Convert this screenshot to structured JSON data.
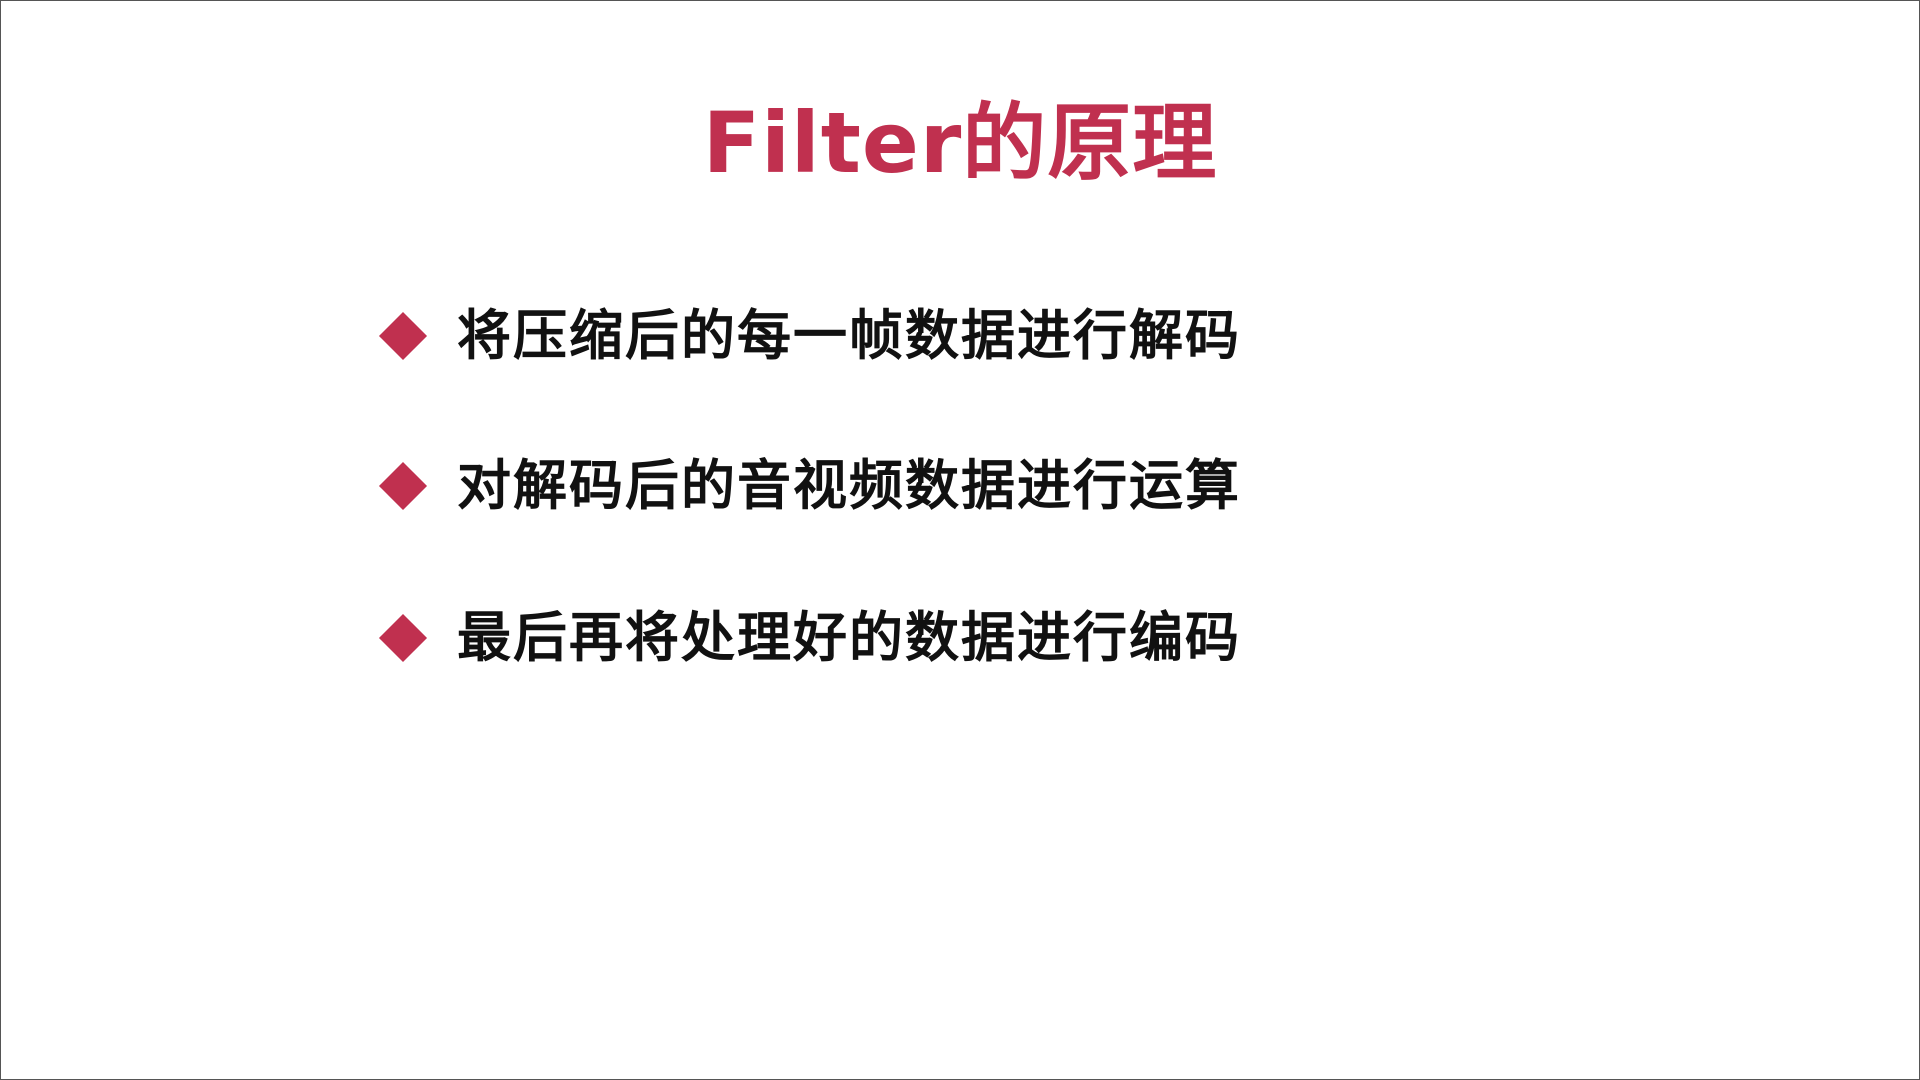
{
  "slide": {
    "title": "Filter的原理",
    "accent_color": "#c0304f",
    "bullet_icon": "diamond-bullet-icon",
    "bullets": [
      "将压缩后的每一帧数据进行解码",
      "对解码后的音视频数据进行运算",
      "最后再将处理好的数据进行编码"
    ]
  }
}
